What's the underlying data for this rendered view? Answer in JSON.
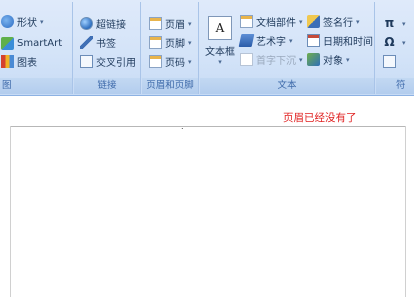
{
  "ribbon": {
    "illustrations": {
      "shapes_label": "形状",
      "smartart_label": "SmartArt",
      "chart_label": "图表",
      "group_label": "图"
    },
    "links": {
      "hyperlink_label": "超链接",
      "bookmark_label": "书签",
      "crossref_label": "交叉引用",
      "group_label": "链接"
    },
    "header_footer": {
      "header_label": "页眉",
      "footer_label": "页脚",
      "page_number_label": "页码",
      "group_label": "页眉和页脚"
    },
    "text": {
      "textbox_label": "文本框",
      "textbox_icon_glyph": "A",
      "quick_parts_label": "文档部件",
      "wordart_label": "艺术字",
      "dropcap_label": "首字下沉",
      "signature_label": "签名行",
      "datetime_label": "日期和时间",
      "object_label": "对象",
      "group_label": "文本"
    },
    "symbols": {
      "equation_glyph": "π",
      "symbol_glyph": "Ω",
      "group_label": "符"
    }
  },
  "document": {
    "header_text": "页眉已经没有了",
    "cursor_mark": "."
  },
  "colors": {
    "ribbon_bg": "#d3e3f8",
    "header_text_color": "#e02020"
  }
}
